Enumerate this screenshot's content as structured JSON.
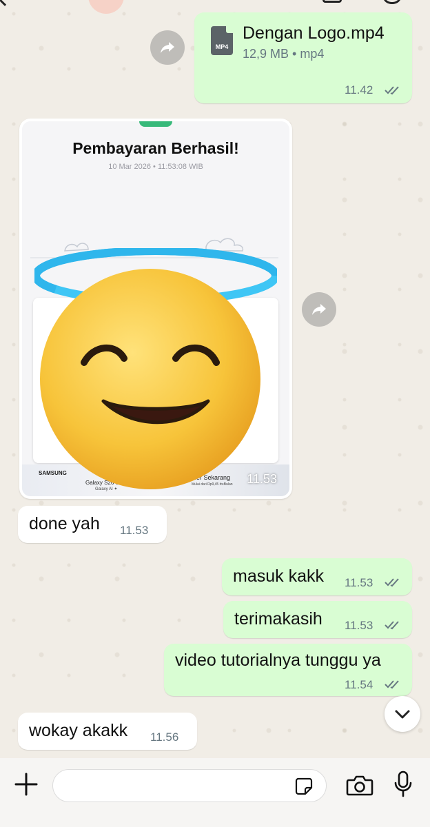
{
  "header": {
    "back_icon": "chevron-left-icon",
    "video_icon": "video-call-icon",
    "call_icon": "phone-icon"
  },
  "messages": {
    "file": {
      "icon_label": "MP4",
      "name": "Dengan Logo.mp4",
      "info": "12,9 MB • mp4",
      "time": "11.42"
    },
    "image": {
      "title": "Pembayaran Berhasil!",
      "date": "10 Mar 2026 • 11:53:08 WIB",
      "promo_brand": "SAMSUNG",
      "promo_model": "Galaxy S26 Series",
      "promo_sub": "Galaxy AI ✦",
      "promo_cta": "Order Sekarang",
      "promo_price": "Mulai dari Rp9,45 rb•Bulan",
      "time": "11.53",
      "sticker": "smiling-face-with-halo"
    },
    "m1": {
      "text": "done yah",
      "time": "11.53"
    },
    "m2": {
      "text": "masuk kakk",
      "time": "11.53"
    },
    "m3": {
      "text": "terimakasih",
      "time": "11.53"
    },
    "m4": {
      "text": "video tutorialnya tunggu ya",
      "time": "11.54"
    },
    "m5": {
      "text": "wokay akakk",
      "time": "11.56"
    }
  },
  "composer": {
    "placeholder": "",
    "plus_icon": "plus-icon",
    "sticker_icon": "sticker-icon",
    "camera_icon": "camera-icon",
    "mic_icon": "microphone-icon"
  },
  "colors": {
    "outgoing": "#d9fdd3",
    "incoming": "#ffffff",
    "wallpaper": "#efeae2"
  }
}
